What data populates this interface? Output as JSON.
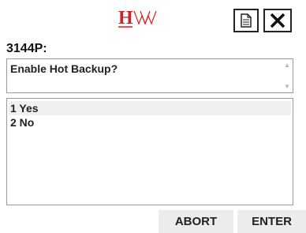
{
  "header": {
    "logo_icon": "hw-logo-icon",
    "logo_letters": "HW",
    "doc_icon": "document-icon",
    "close_icon": "close-icon"
  },
  "device": {
    "label": "3144P:"
  },
  "prompt": {
    "text": "Enable Hot Backup?",
    "scroll_icons": [
      "scroll-up-icon",
      "scroll-down-icon"
    ]
  },
  "options": [
    {
      "label": "1 Yes",
      "selected": true
    },
    {
      "label": "2 No",
      "selected": false
    }
  ],
  "footer": {
    "abort_label": "ABORT",
    "enter_label": "ENTER"
  },
  "colors": {
    "logo_red": "#d42020",
    "border": "#9a9a9a",
    "button_bg": "#ececec",
    "selected_bg": "#f0f0f0"
  }
}
